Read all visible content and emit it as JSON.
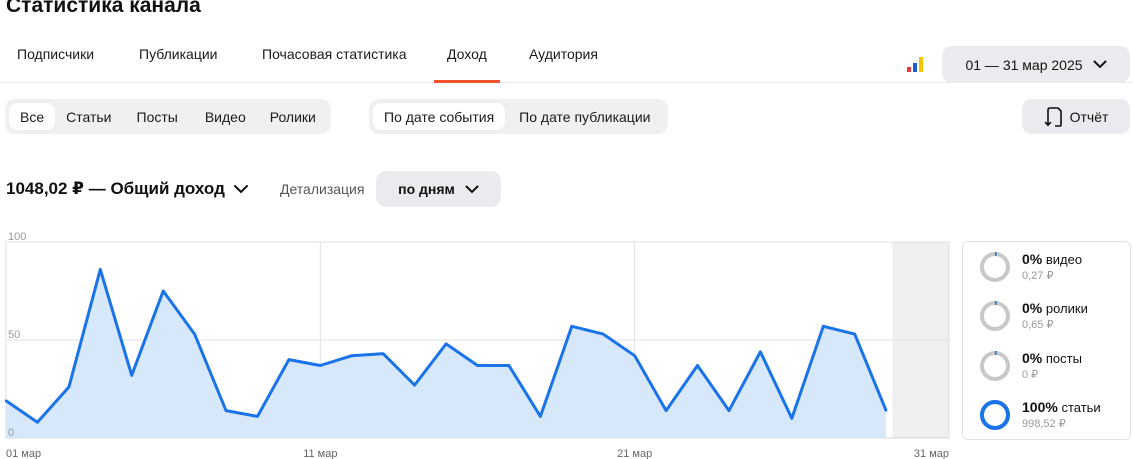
{
  "page_title": "Статистика канала",
  "tabs": [
    {
      "label": "Подписчики",
      "active": false
    },
    {
      "label": "Публикации",
      "active": false
    },
    {
      "label": "Почасовая статистика",
      "active": false
    },
    {
      "label": "Доход",
      "active": true
    },
    {
      "label": "Аудитория",
      "active": false
    }
  ],
  "date_range": "01 — 31 мар 2025",
  "content_filter": [
    "Все",
    "Статьи",
    "Посты",
    "Видео",
    "Ролики"
  ],
  "date_filter": [
    "По дате события",
    "По дате публикации"
  ],
  "report_label": "Отчёт",
  "total_income": "1048,02 ₽ — Общий доход",
  "detail_label": "Детализация",
  "detail_value": "по дням",
  "colors": {
    "accent": "#f0532d",
    "line": "#1a73e8",
    "fill": "#d7e8fb"
  },
  "legend": [
    {
      "pct": "0%",
      "name": "видео",
      "amount": "0,27 ₽",
      "share": 0.003
    },
    {
      "pct": "0%",
      "name": "ролики",
      "amount": "0,65 ₽",
      "share": 0.006
    },
    {
      "pct": "0%",
      "name": "посты",
      "amount": "0 ₽",
      "share": 0.0
    },
    {
      "pct": "100%",
      "name": "статьи",
      "amount": "998,52 ₽",
      "share": 1.0
    }
  ],
  "chart_data": {
    "type": "area",
    "y_ticks": [
      "100",
      "50",
      "0"
    ],
    "ylim": [
      0,
      100
    ],
    "x_ticks": [
      "01 мар",
      "11 мар",
      "21 мар",
      "31 мар"
    ],
    "x": [
      1,
      2,
      3,
      4,
      5,
      6,
      7,
      8,
      9,
      10,
      11,
      12,
      13,
      14,
      15,
      16,
      17,
      18,
      19,
      20,
      21,
      22,
      23,
      24,
      25,
      26,
      27,
      28,
      29
    ],
    "values": [
      19,
      8,
      26,
      86,
      32,
      75,
      53,
      14,
      11,
      40,
      37,
      42,
      43,
      27,
      48,
      37,
      37,
      11,
      57,
      53,
      42,
      14,
      37,
      14,
      44,
      10,
      57,
      53,
      14
    ],
    "grid": true
  }
}
